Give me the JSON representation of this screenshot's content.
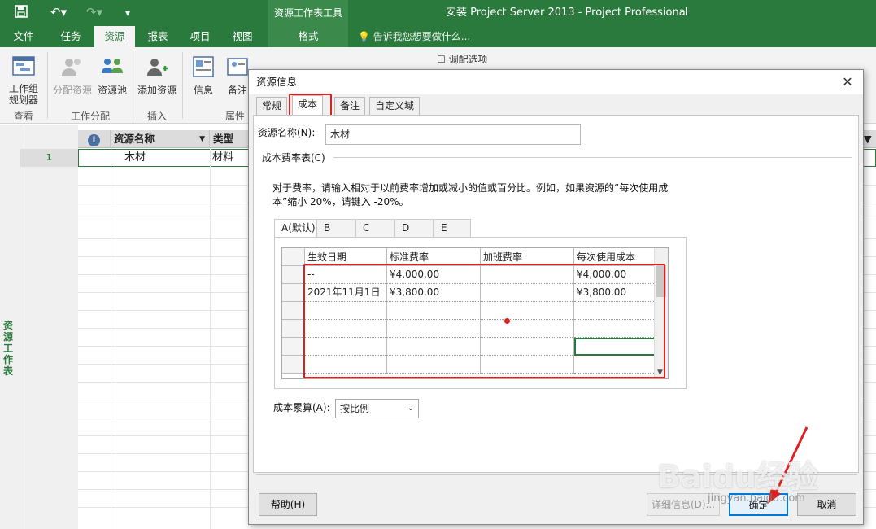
{
  "app": {
    "title": "安装 Project Server 2013 - Project Professional",
    "context_tools": "资源工作表工具",
    "context_tab": "格式",
    "tell_me": "告诉我您想要做什么..."
  },
  "ribbon": {
    "tabs": [
      "文件",
      "任务",
      "资源",
      "报表",
      "项目",
      "视图"
    ],
    "active_tab": "资源",
    "buttons": {
      "team_planner": "工作组规划器",
      "assign_resources": "分配资源",
      "resource_pool": "资源池",
      "add_resources": "添加资源",
      "information": "信息",
      "notes": "备注",
      "leveling_options": "调配选项"
    },
    "groups": {
      "view": "查看",
      "assignments": "工作分配",
      "insert": "插入",
      "properties": "属性"
    }
  },
  "sheet": {
    "side_label": "资源工作表",
    "columns": [
      "资源名称",
      "类型"
    ],
    "rows": [
      {
        "num": "1",
        "name": "木材",
        "type": "材料"
      }
    ]
  },
  "dialog": {
    "title": "资源信息",
    "tabs": [
      "常规",
      "成本",
      "备注",
      "自定义域"
    ],
    "active_tab": "成本",
    "resource_name_label": "资源名称(N):",
    "resource_name_value": "木材",
    "cost_rate_tables_label": "成本费率表(C)",
    "instructions": "对于费率，请输入相对于以前费率增加或减小的值或百分比。例如，如果资源的“每次使用成本”缩小 20%，请键入 -20%。",
    "rate_tabs": [
      "A(默认)",
      "B",
      "C",
      "D",
      "E"
    ],
    "active_rate_tab": "A(默认)",
    "table": {
      "headers": [
        "生效日期",
        "标准费率",
        "加班费率",
        "每次使用成本"
      ],
      "rows": [
        [
          "--",
          "¥4,000.00",
          "",
          "¥4,000.00"
        ],
        [
          "2021年11月1日",
          "¥3,800.00",
          "",
          "¥3,800.00"
        ],
        [
          "",
          "",
          "",
          ""
        ],
        [
          "",
          "",
          "",
          ""
        ],
        [
          "",
          "",
          "",
          ""
        ],
        [
          "",
          "",
          "",
          ""
        ]
      ]
    },
    "cost_accrual_label": "成本累算(A):",
    "cost_accrual_value": "按比例",
    "buttons": {
      "help": "帮助(H)",
      "details": "详细信息(D)...",
      "ok": "确定",
      "cancel": "取消"
    }
  },
  "watermark": {
    "brand": "Baidu经验",
    "url": "jingyan.baidu.com"
  },
  "colors": {
    "ribbon_green": "#2b7a3d",
    "highlight_red": "#e02020",
    "primary_blue": "#0078d7"
  }
}
